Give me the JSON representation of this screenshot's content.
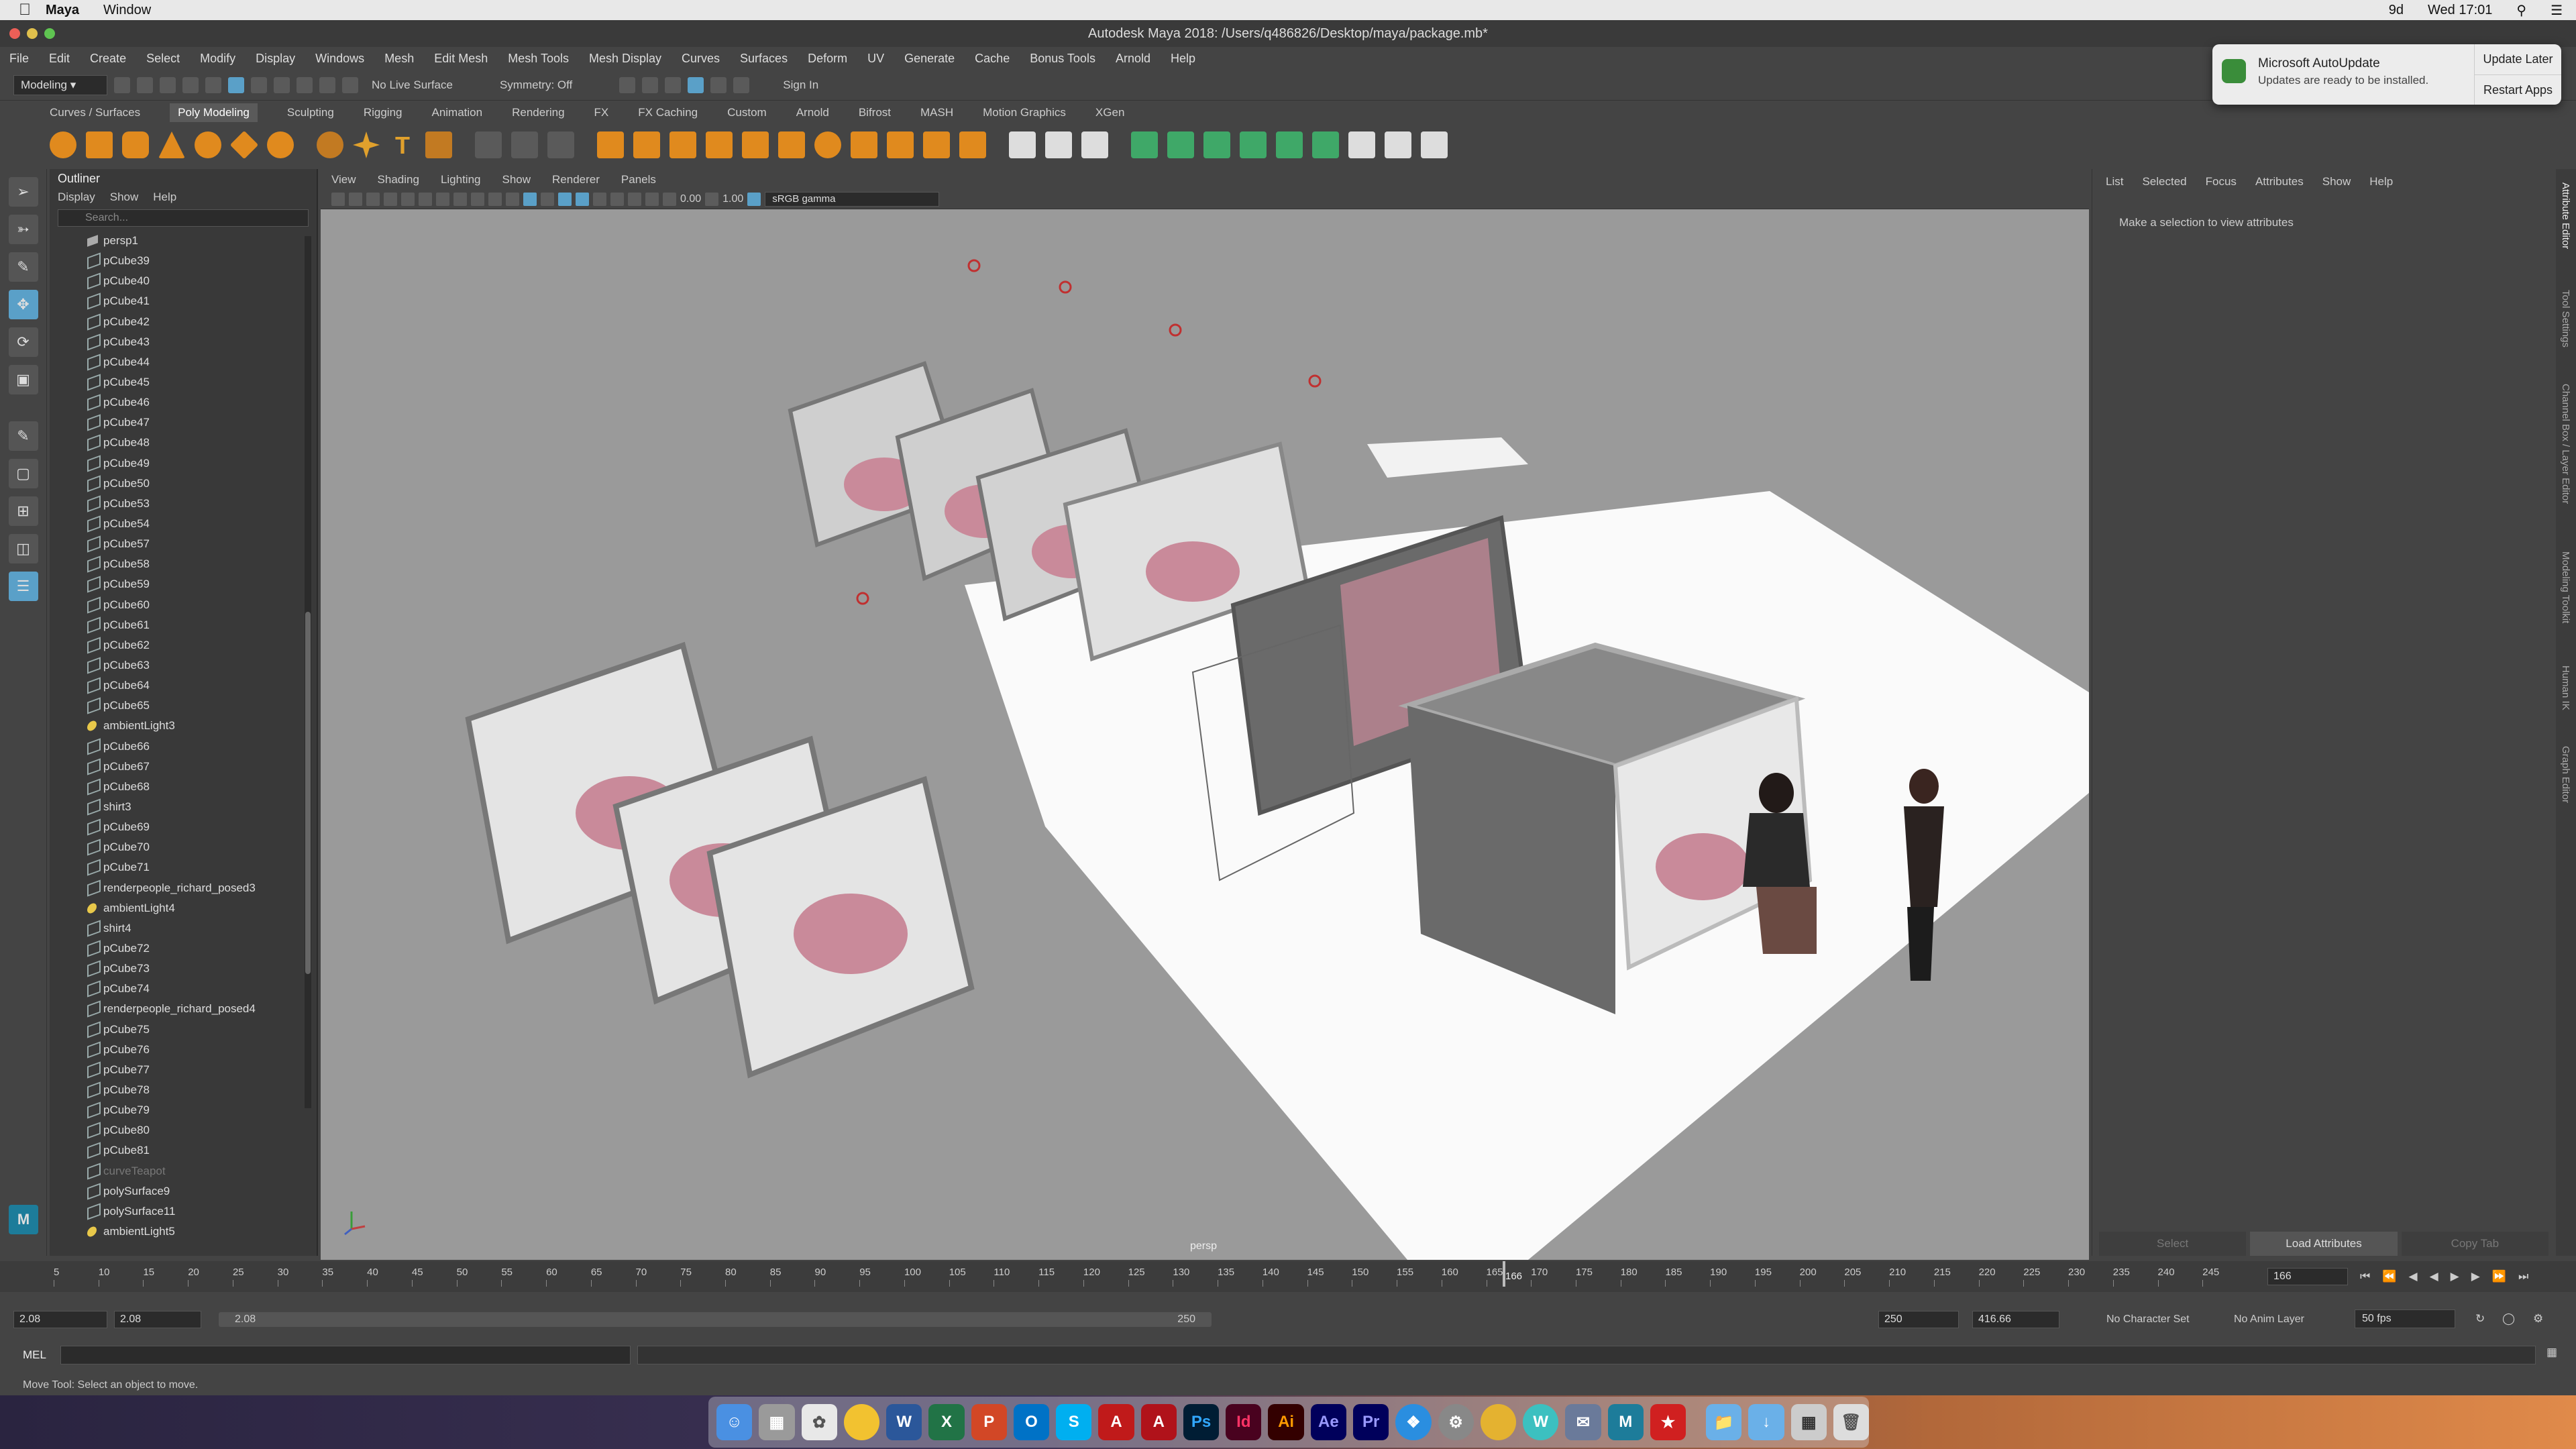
{
  "mac_menubar": {
    "app": "Maya",
    "items": [
      "Window"
    ],
    "clock": "Wed 17:01",
    "battery": "9d"
  },
  "window_title": "Autodesk Maya 2018: /Users/q486826/Desktop/maya/package.mb*",
  "menus": [
    "File",
    "Edit",
    "Create",
    "Select",
    "Modify",
    "Display",
    "Windows",
    "Mesh",
    "Edit Mesh",
    "Mesh Tools",
    "Mesh Display",
    "Curves",
    "Surfaces",
    "Deform",
    "UV",
    "Generate",
    "Cache",
    "Bonus Tools",
    "Arnold",
    "Help"
  ],
  "status_line": {
    "mode": "Modeling",
    "live_surface": "No Live Surface",
    "symmetry": "Symmetry: Off",
    "sign_in": "Sign In"
  },
  "shelf_tabs": [
    "Curves / Surfaces",
    "Poly Modeling",
    "Sculpting",
    "Rigging",
    "Animation",
    "Rendering",
    "FX",
    "FX Caching",
    "Custom",
    "Arnold",
    "Bifrost",
    "MASH",
    "Motion Graphics",
    "XGen"
  ],
  "shelf_active": "Poly Modeling",
  "outliner": {
    "title": "Outliner",
    "menu": [
      "Display",
      "Show",
      "Help"
    ],
    "search_placeholder": "Search...",
    "items": [
      {
        "name": "persp1",
        "kind": "cam"
      },
      {
        "name": "pCube39",
        "kind": "mesh"
      },
      {
        "name": "pCube40",
        "kind": "mesh"
      },
      {
        "name": "pCube41",
        "kind": "mesh"
      },
      {
        "name": "pCube42",
        "kind": "mesh"
      },
      {
        "name": "pCube43",
        "kind": "mesh"
      },
      {
        "name": "pCube44",
        "kind": "mesh"
      },
      {
        "name": "pCube45",
        "kind": "mesh"
      },
      {
        "name": "pCube46",
        "kind": "mesh"
      },
      {
        "name": "pCube47",
        "kind": "mesh"
      },
      {
        "name": "pCube48",
        "kind": "mesh"
      },
      {
        "name": "pCube49",
        "kind": "mesh"
      },
      {
        "name": "pCube50",
        "kind": "mesh"
      },
      {
        "name": "pCube53",
        "kind": "mesh"
      },
      {
        "name": "pCube54",
        "kind": "mesh"
      },
      {
        "name": "pCube57",
        "kind": "mesh"
      },
      {
        "name": "pCube58",
        "kind": "mesh"
      },
      {
        "name": "pCube59",
        "kind": "mesh"
      },
      {
        "name": "pCube60",
        "kind": "mesh"
      },
      {
        "name": "pCube61",
        "kind": "mesh"
      },
      {
        "name": "pCube62",
        "kind": "mesh"
      },
      {
        "name": "pCube63",
        "kind": "mesh"
      },
      {
        "name": "pCube64",
        "kind": "mesh"
      },
      {
        "name": "pCube65",
        "kind": "mesh"
      },
      {
        "name": "ambientLight3",
        "kind": "light"
      },
      {
        "name": "pCube66",
        "kind": "mesh"
      },
      {
        "name": "pCube67",
        "kind": "mesh"
      },
      {
        "name": "pCube68",
        "kind": "mesh"
      },
      {
        "name": "shirt3",
        "kind": "mesh"
      },
      {
        "name": "pCube69",
        "kind": "mesh"
      },
      {
        "name": "pCube70",
        "kind": "mesh"
      },
      {
        "name": "pCube71",
        "kind": "mesh"
      },
      {
        "name": "renderpeople_richard_posed3",
        "kind": "mesh"
      },
      {
        "name": "ambientLight4",
        "kind": "light"
      },
      {
        "name": "shirt4",
        "kind": "mesh"
      },
      {
        "name": "pCube72",
        "kind": "mesh"
      },
      {
        "name": "pCube73",
        "kind": "mesh"
      },
      {
        "name": "pCube74",
        "kind": "mesh"
      },
      {
        "name": "renderpeople_richard_posed4",
        "kind": "mesh"
      },
      {
        "name": "pCube75",
        "kind": "mesh"
      },
      {
        "name": "pCube76",
        "kind": "mesh"
      },
      {
        "name": "pCube77",
        "kind": "mesh"
      },
      {
        "name": "pCube78",
        "kind": "mesh"
      },
      {
        "name": "pCube79",
        "kind": "mesh"
      },
      {
        "name": "pCube80",
        "kind": "mesh"
      },
      {
        "name": "pCube81",
        "kind": "mesh"
      },
      {
        "name": "curveTeapot",
        "kind": "dim"
      },
      {
        "name": "polySurface9",
        "kind": "mesh"
      },
      {
        "name": "polySurface11",
        "kind": "mesh"
      },
      {
        "name": "ambientLight5",
        "kind": "light"
      }
    ]
  },
  "viewport": {
    "menu": [
      "View",
      "Shading",
      "Lighting",
      "Show",
      "Renderer",
      "Panels"
    ],
    "exposure": "0.00",
    "gamma": "1.00",
    "colorspace": "sRGB gamma",
    "camera_label": "persp"
  },
  "attribute_editor": {
    "menu": [
      "List",
      "Selected",
      "Focus",
      "Attributes",
      "Show",
      "Help"
    ],
    "message": "Make a selection to view attributes",
    "buttons": [
      "Select",
      "Load Attributes",
      "Copy Tab"
    ],
    "side_tabs": [
      "Attribute Editor",
      "Tool Settings",
      "Channel Box / Layer Editor",
      "Modeling Toolkit",
      "Human IK",
      "Graph Editor"
    ]
  },
  "notification": {
    "title": "Microsoft AutoUpdate",
    "body": "Updates are ready to be installed.",
    "btn1": "Update Later",
    "btn2": "Restart Apps"
  },
  "timeline": {
    "ticks": [
      "5",
      "10",
      "15",
      "20",
      "25",
      "30",
      "35",
      "40",
      "45",
      "50",
      "55",
      "60",
      "65",
      "70",
      "75",
      "80",
      "85",
      "90",
      "95",
      "100",
      "105",
      "110",
      "115",
      "120",
      "125",
      "130",
      "135",
      "140",
      "145",
      "150",
      "155",
      "160",
      "165",
      "170",
      "175",
      "180",
      "185",
      "190",
      "195",
      "200",
      "205",
      "210",
      "215",
      "220",
      "225",
      "230",
      "235",
      "240",
      "245"
    ],
    "current_frame": "166",
    "current_frame_field": "166"
  },
  "range": {
    "start": "2.08",
    "start2": "2.08",
    "slider_start": "2.08",
    "slider_end": "250",
    "end": "250",
    "end2": "416.66",
    "character_set": "No Character Set",
    "anim_layer": "No Anim Layer",
    "fps": "50 fps"
  },
  "command_line": {
    "label": "MEL"
  },
  "help_line": "Move Tool: Select an object to move.",
  "dock": [
    "Finder",
    "Launchpad",
    "Photos",
    "Chrome",
    "Word",
    "Excel",
    "PowerPoint",
    "Outlook",
    "Skype",
    "Acrobat",
    "Reader",
    "Ps",
    "Id",
    "Ai",
    "Ae",
    "Pr",
    "Safari",
    "Prefs",
    "Chrome",
    "W",
    "Mail",
    "Maya",
    "Flashcard",
    "Folder",
    "Downloads",
    "Preview",
    "Trash"
  ]
}
